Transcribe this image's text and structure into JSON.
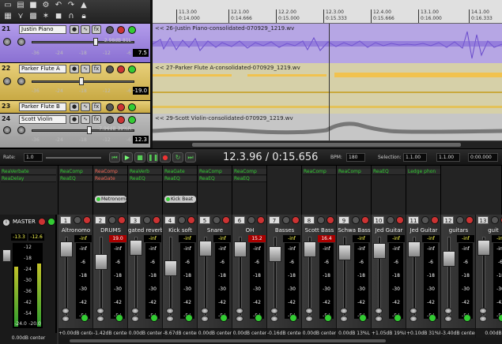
{
  "colors": {
    "track_purple": "#a58be0",
    "track_yellow": "#e0c65a",
    "track_grey": "#a9a9a9",
    "waveform_purple": "#7a5cd6",
    "waveform_yellow": "#f1c24e",
    "waveform_grey": "#8e8e8e",
    "fx_green": "#33cc33",
    "meter_text": "#ffff55"
  },
  "tracks": [
    {
      "num": "21",
      "name": "Justin Piano",
      "db": "-2.98dB 81L",
      "vol": "7.5",
      "color": "track_purple"
    },
    {
      "num": "22",
      "name": "Parker Flute A",
      "db": "",
      "vol": "-19.0",
      "color": "track_yellow"
    },
    {
      "num": "23",
      "name": "Parker Flute B",
      "db": "",
      "vol": "",
      "color": "track_yellow"
    },
    {
      "num": "24",
      "name": "Scott Violin",
      "db": "-7.96dB 39%R",
      "vol": "12.3",
      "color": "track_grey"
    }
  ],
  "track_scale": [
    "-36",
    "-24",
    "-18",
    "-12",
    "-6"
  ],
  "ruler": [
    {
      "bar": "11.3.00",
      "time": "0:14.000"
    },
    {
      "bar": "12.1.00",
      "time": "0:14.666"
    },
    {
      "bar": "12.2.00",
      "time": "0:15.000"
    },
    {
      "bar": "12.3.00",
      "time": "0:15.333"
    },
    {
      "bar": "12.4.00",
      "time": "0:15.666"
    },
    {
      "bar": "13.1.00",
      "time": "0:16.000"
    },
    {
      "bar": "14.1.00",
      "time": "0:16.333"
    }
  ],
  "clips": [
    {
      "label": "<< 26-Justin Piano-consolidated-070929_1219.wv"
    },
    {
      "label": "<< 27-Parker Flute A-consolidated-070929_1219.wv"
    },
    {
      "label": "<< 29-Scott Violin-consolidated-070929_1219.wv"
    }
  ],
  "transport": {
    "rate_label": "Rate:",
    "rate_value": "1.0",
    "timecode": "12.3.96 / 0:15.656",
    "bpm_label": "BPM:",
    "bpm_value": "180",
    "selection_label": "Selection:",
    "sel_start": "1.1.00",
    "sel_end": "1.1.00",
    "sel_len": "0:00.000"
  },
  "fx_columns": [
    {
      "slots": [
        "ReaVerbate",
        "ReaDelay"
      ],
      "io": ""
    },
    {
      "slots": [
        "ReaComp",
        "ReaEQ"
      ],
      "io": ""
    },
    {
      "slots": [
        "ReaComp",
        "ReaGate"
      ],
      "io": "Metronome"
    },
    {
      "slots": [
        "ReaVerb",
        "ReaEQ"
      ],
      "io": ""
    },
    {
      "slots": [
        "ReaGate",
        "ReaEQ"
      ],
      "io": "Kick Beat"
    },
    {
      "slots": [
        "ReaComp",
        "ReaEQ"
      ],
      "io": ""
    },
    {
      "slots": [
        "ReaComp",
        "ReaEQ"
      ],
      "io": ""
    },
    {
      "slots": [],
      "io": ""
    },
    {
      "slots": [
        "ReaComp"
      ],
      "io": ""
    },
    {
      "slots": [
        "ReaComp"
      ],
      "io": ""
    },
    {
      "slots": [
        "ReaEQ"
      ],
      "io": ""
    },
    {
      "slots": [
        "Ledge phon"
      ],
      "io": ""
    },
    {
      "slots": [],
      "io": ""
    }
  ],
  "master": {
    "label": "MASTER",
    "peak_l": "-13.3",
    "peak_r": "-12.6",
    "db": "0.00dB center",
    "scale": [
      "-12",
      "-18",
      "-24",
      "-30",
      "-36",
      "-42",
      "-54",
      "-24.0",
      "-20.0"
    ]
  },
  "mixer_strips": [
    {
      "num": "1",
      "name": "Altronomo",
      "peak": "-inf",
      "red": false,
      "db": "+0.00dB center"
    },
    {
      "num": "2",
      "name": "DRUMS",
      "peak": "19.0",
      "red": true,
      "db": "-1.42dB center"
    },
    {
      "num": "3",
      "name": "gated reverb",
      "peak": "-inf",
      "red": false,
      "db": "0.00dB center"
    },
    {
      "num": "4",
      "name": "Kick soft",
      "peak": "-inf",
      "red": false,
      "db": "-8.67dB center"
    },
    {
      "num": "5",
      "name": "Snare",
      "peak": "-inf",
      "red": false,
      "db": "0.00dB center"
    },
    {
      "num": "6",
      "name": "OH",
      "peak": "15.2",
      "red": true,
      "db": "0.00dB center"
    },
    {
      "num": "7",
      "name": "Basses",
      "peak": "-inf",
      "red": false,
      "db": "-0.16dB center"
    },
    {
      "num": "8",
      "name": "Scott Bass",
      "peak": "16.4",
      "red": true,
      "db": "0.00dB center"
    },
    {
      "num": "9",
      "name": "Schwa Bass",
      "peak": "-inf",
      "red": false,
      "db": "0.00dB 13%L"
    },
    {
      "num": "10",
      "name": "Jed Guitar",
      "peak": "-inf",
      "red": false,
      "db": "+1.05dB 19%L"
    },
    {
      "num": "11",
      "name": "Jed Guitar",
      "peak": "-inf",
      "red": false,
      "db": "+0.10dB 31%R"
    },
    {
      "num": "12",
      "name": "guitars",
      "peak": "-inf",
      "red": false,
      "db": "-3.40dB center"
    },
    {
      "num": "13",
      "name": "guit",
      "peak": "-inf",
      "red": false,
      "db": "0.00dB"
    }
  ],
  "meter_scale": [
    "-inf",
    "-6",
    "-18",
    "-30",
    "-42",
    "-54"
  ]
}
